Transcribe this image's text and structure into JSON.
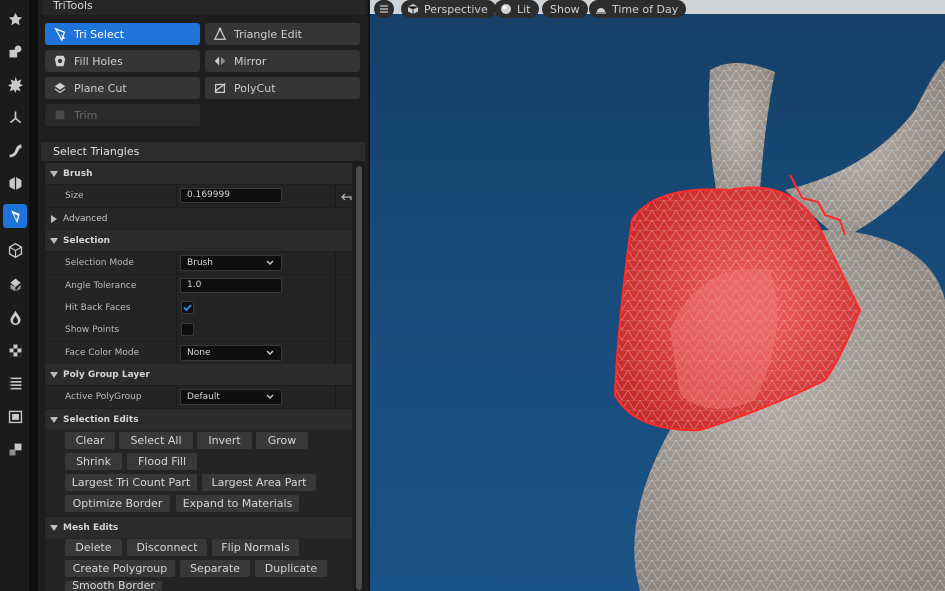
{
  "panel": {
    "title": "TriTools"
  },
  "tools": [
    {
      "label": "Tri Select",
      "icon": "tri-select-icon",
      "active": true
    },
    {
      "label": "Triangle Edit",
      "icon": "triangle-edit-icon"
    },
    {
      "label": "Fill Holes",
      "icon": "fill-holes-icon"
    },
    {
      "label": "Mirror",
      "icon": "mirror-icon"
    },
    {
      "label": "Plane Cut",
      "icon": "plane-cut-icon"
    },
    {
      "label": "PolyCut",
      "icon": "polycut-icon"
    },
    {
      "label": "Trim",
      "icon": "trim-icon",
      "disabled": true
    }
  ],
  "details": {
    "title": "Select Triangles",
    "brush": {
      "header": "Brush",
      "size_label": "Size",
      "size_value": "0.169999"
    },
    "advanced": {
      "header": "Advanced"
    },
    "selection": {
      "header": "Selection",
      "mode_label": "Selection Mode",
      "mode_value": "Brush",
      "angle_label": "Angle Tolerance",
      "angle_value": "1.0",
      "hit_back_label": "Hit Back Faces",
      "hit_back_checked": true,
      "show_points_label": "Show Points",
      "show_points_checked": false,
      "face_color_label": "Face Color Mode",
      "face_color_value": "None"
    },
    "poly_group_layer": {
      "header": "Poly Group Layer",
      "active_label": "Active PolyGroup",
      "active_value": "Default"
    },
    "selection_edits": {
      "header": "Selection Edits",
      "buttons": [
        "Clear",
        "Select All",
        "Invert",
        "Grow",
        "Shrink",
        "Flood Fill",
        "Largest Tri Count Part",
        "Largest Area Part",
        "Optimize Border",
        "Expand to Materials"
      ]
    },
    "mesh_edits": {
      "header": "Mesh Edits",
      "buttons": [
        "Delete",
        "Disconnect",
        "Flip Normals",
        "Create Polygroup",
        "Separate",
        "Duplicate",
        "Smooth Border"
      ]
    }
  },
  "viewport": {
    "menu_icon": "hamburger-icon",
    "perspective": "Perspective",
    "lit": "Lit",
    "show": "Show",
    "time_of_day": "Time of Day",
    "background_color": "#174a78",
    "mesh_color": "#9b948f",
    "selection_color": "#e03a3a"
  },
  "colors": {
    "accent": "#1f74d9"
  }
}
